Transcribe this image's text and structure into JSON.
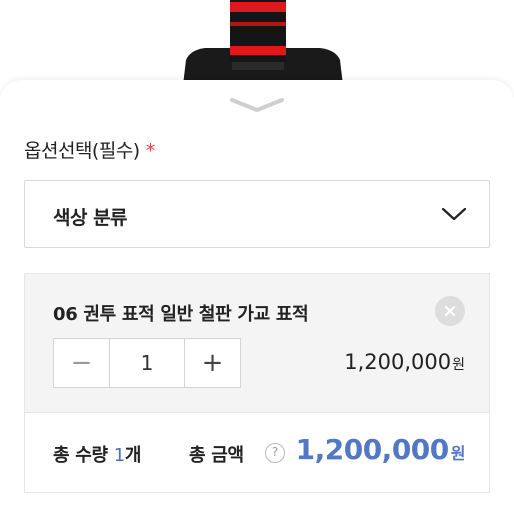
{
  "option_section": {
    "title": "옵션선택(필수)",
    "required_mark": "*",
    "select": {
      "value": "색상 분류"
    }
  },
  "selected_item": {
    "name": "06 권투 표적 일반 철판 가교 표적",
    "quantity": "1",
    "price": "1,200,000",
    "price_unit": "원",
    "decrement_symbol": "−",
    "increment_symbol": "+"
  },
  "total": {
    "qty_label": "총 수량",
    "qty_value": "1",
    "qty_unit": "개",
    "amount_label": "총 금액",
    "help_symbol": "?",
    "amount_value": "1,200,000",
    "amount_unit": "원"
  },
  "colors": {
    "accent_blue": "#5277c4",
    "required_red": "#e8424b",
    "product_red": "#e01818",
    "product_black": "#151515"
  },
  "icons": {
    "handle": "chevron-down-icon",
    "select_arrow": "chevron-down-icon",
    "remove": "close-circle-icon",
    "help": "question-circle-icon"
  }
}
